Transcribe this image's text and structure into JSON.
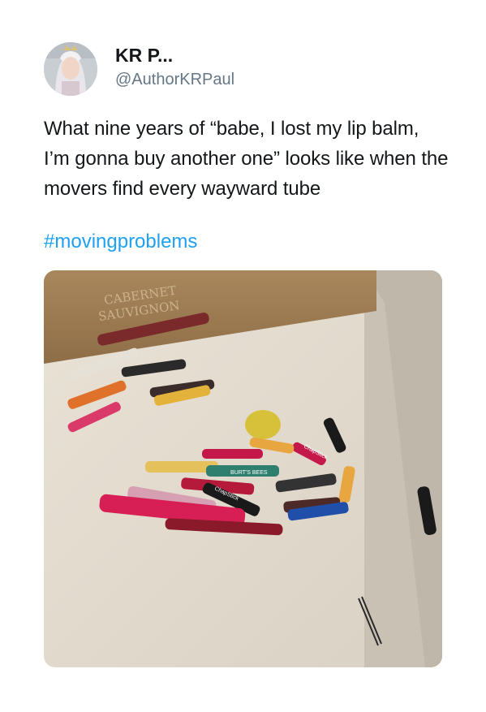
{
  "tweet": {
    "display_name": "KR P...",
    "handle": "@AuthorKRPaul",
    "text": "What nine years of “babe, I lost my lip balm, I’m gonna buy another one” looks like when the movers find every wayward tube",
    "hashtag": "#movingproblems"
  },
  "photo": {
    "crate_text_line1": "CABERNET",
    "crate_text_line2": "SAUVIGNON",
    "tube_label_1": "ChapStick",
    "tube_label_2": "ChapStick",
    "tube_label_3": "BURT'S BEES"
  },
  "colors": {
    "link": "#1da1f2",
    "handle": "#657786",
    "text": "#14171a"
  }
}
